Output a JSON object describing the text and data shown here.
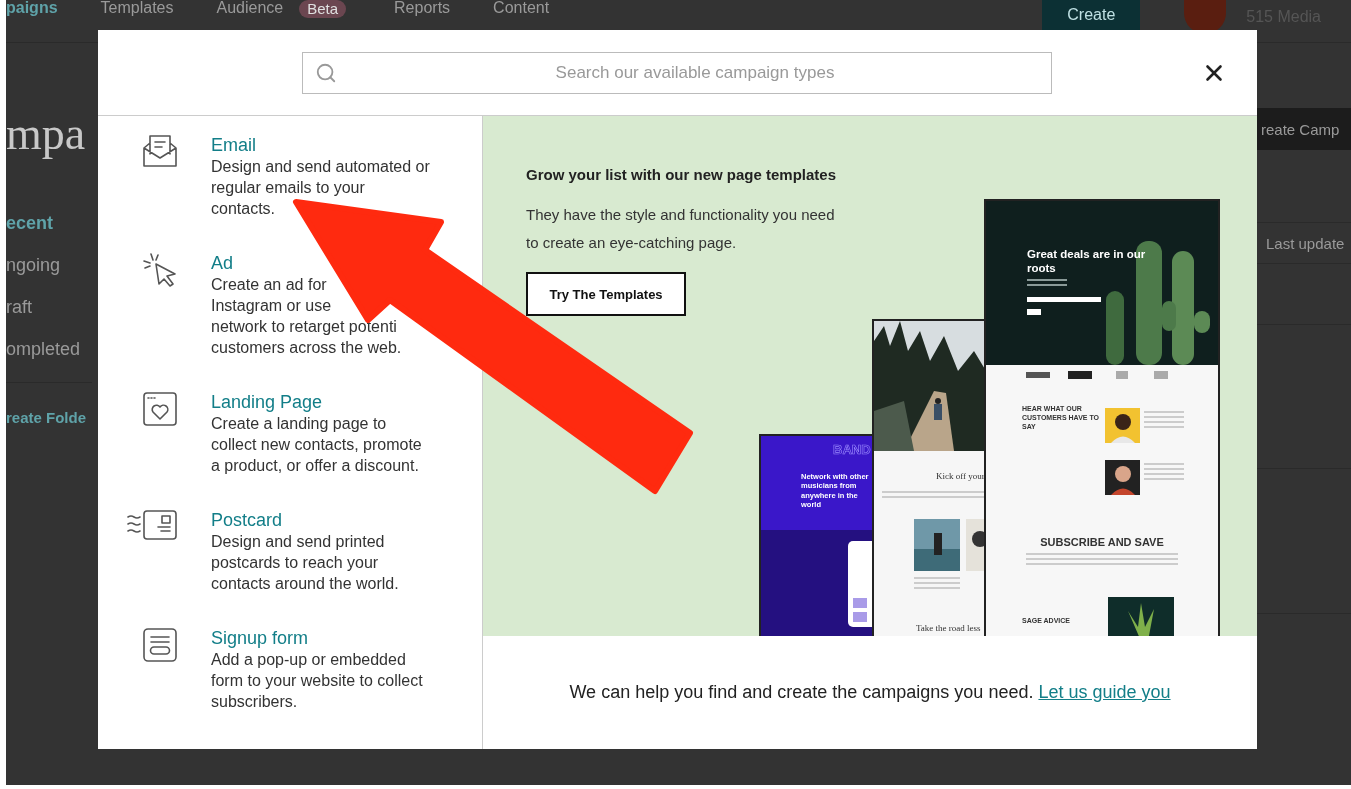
{
  "background_page": {
    "nav": [
      {
        "label": "paigns",
        "selected": true
      },
      {
        "label": "Templates",
        "selected": false
      },
      {
        "label": "Audience",
        "selected": false,
        "badge": "Beta"
      },
      {
        "label": "Reports",
        "selected": false
      },
      {
        "label": "Content",
        "selected": false
      }
    ],
    "create_button": "Create",
    "account": "515 Media",
    "title": "mpa",
    "filters": [
      {
        "label": "ecent",
        "selected": true
      },
      {
        "label": "ngoing",
        "selected": false
      },
      {
        "label": "raft",
        "selected": false
      },
      {
        "label": "ompleted",
        "selected": false
      }
    ],
    "create_folder": "reate Folde",
    "create_campaign_button": "reate Camp",
    "sort_label": "Last update"
  },
  "modal": {
    "search": {
      "placeholder": "Search our available campaign types"
    },
    "types": [
      {
        "kind": "email",
        "title": "Email",
        "description_lines": [
          "Design and send automated or",
          "regular emails to your",
          "contacts."
        ]
      },
      {
        "kind": "ad",
        "title": "Ad",
        "description_lines": [
          "Create an ad for",
          "Instagram or use",
          "network to retarget potenti",
          "customers across the web."
        ]
      },
      {
        "kind": "landing",
        "title": "Landing Page",
        "description_lines": [
          "Create a landing page to",
          "collect new contacts, promote",
          "a product, or offer a discount."
        ]
      },
      {
        "kind": "postcard",
        "title": "Postcard",
        "description_lines": [
          "Design and send printed",
          "postcards to reach your",
          "contacts around the world."
        ]
      },
      {
        "kind": "signup",
        "title": "Signup form",
        "description_lines": [
          "Add a pop-up or embedded",
          "form to your website to collect",
          "subscribers."
        ]
      }
    ],
    "promo": {
      "heading": "Grow your list with our new page templates",
      "text_lines": [
        "They have the style and functionality you need",
        "to create an eye-catching page."
      ],
      "button": "Try The Templates",
      "previews": [
        {
          "kind": "band",
          "logo": "BAND",
          "headline": "Network with other musicians from anywhere in the world"
        },
        {
          "kind": "travel",
          "heading": "Kick off your",
          "subheading": "Take the road less"
        },
        {
          "kind": "garden",
          "headline": "Great deals are in our roots",
          "section_title": "HEAR WHAT OUR CUSTOMERS HAVE TO SAY",
          "banner": "SUBSCRIBE AND SAVE",
          "footer_title": "SAGE ADVICE"
        }
      ]
    },
    "footer": {
      "text": "We can help you find and create the campaigns you need.",
      "link": "Let us guide you"
    }
  },
  "annotation": {
    "kind": "arrow"
  }
}
